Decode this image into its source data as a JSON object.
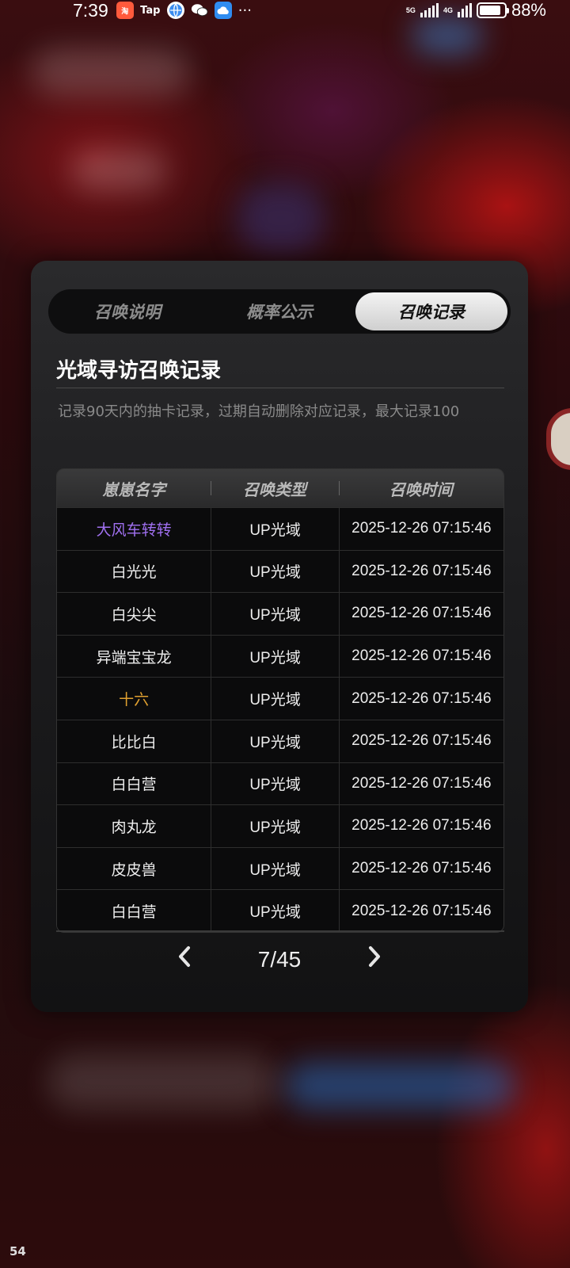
{
  "status_bar": {
    "time": "7:39",
    "battery": "88%",
    "battery_level": 0.88,
    "app_icons": [
      "taobao-icon",
      "tap-icon",
      "browser-icon",
      "wechat-icon",
      "cloud-icon"
    ],
    "tap_label": "Tap",
    "more": "···",
    "net1": "5G",
    "net2": "4G"
  },
  "tabs": [
    {
      "label": "召唤说明",
      "active": false
    },
    {
      "label": "概率公示",
      "active": false
    },
    {
      "label": "召唤记录",
      "active": true
    }
  ],
  "title": "光域寻访召唤记录",
  "description": "记录90天内的抽卡记录，过期自动删除对应记录，最大记录100",
  "table": {
    "headers": [
      "崽崽名字",
      "召唤类型",
      "召唤时间"
    ],
    "rows": [
      {
        "name": "大风车转转",
        "type": "UP光域",
        "time": "2025-12-26 07:15:46",
        "color": "#a070f0"
      },
      {
        "name": "白光光",
        "type": "UP光域",
        "time": "2025-12-26 07:15:46",
        "color": "#eeeeee"
      },
      {
        "name": "白尖尖",
        "type": "UP光域",
        "time": "2025-12-26 07:15:46",
        "color": "#eeeeee"
      },
      {
        "name": "异端宝宝龙",
        "type": "UP光域",
        "time": "2025-12-26 07:15:46",
        "color": "#eeeeee"
      },
      {
        "name": "十六",
        "type": "UP光域",
        "time": "2025-12-26 07:15:46",
        "color": "#e0a030"
      },
      {
        "name": "比比白",
        "type": "UP光域",
        "time": "2025-12-26 07:15:46",
        "color": "#eeeeee"
      },
      {
        "name": "白白营",
        "type": "UP光域",
        "time": "2025-12-26 07:15:46",
        "color": "#eeeeee"
      },
      {
        "name": "肉丸龙",
        "type": "UP光域",
        "time": "2025-12-26 07:15:46",
        "color": "#eeeeee"
      },
      {
        "name": "皮皮兽",
        "type": "UP光域",
        "time": "2025-12-26 07:15:46",
        "color": "#eeeeee"
      },
      {
        "name": "白白营",
        "type": "UP光域",
        "time": "2025-12-26 07:15:46",
        "color": "#eeeeee"
      }
    ]
  },
  "pager": {
    "text": "7/45",
    "prev_icon": "chevron-left-icon",
    "next_icon": "chevron-right-icon"
  },
  "corner_label": "54"
}
